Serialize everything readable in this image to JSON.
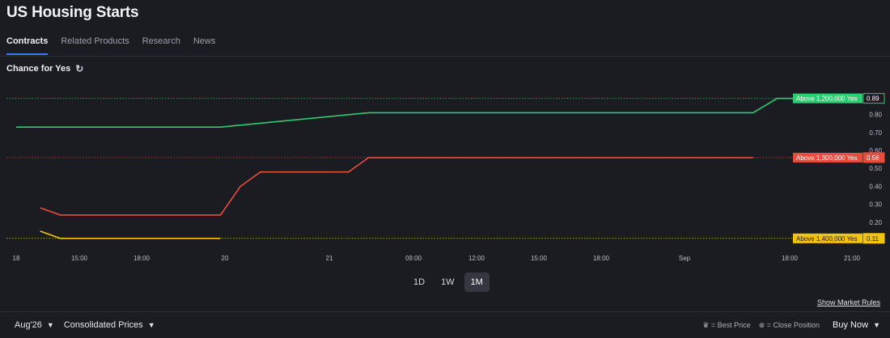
{
  "page": {
    "title": "US Housing Starts"
  },
  "tabs": [
    {
      "label": "Contracts",
      "active": true
    },
    {
      "label": "Related Products"
    },
    {
      "label": "Research"
    },
    {
      "label": "News"
    }
  ],
  "chart_header": {
    "label": "Chance for Yes"
  },
  "chart_data": {
    "type": "line",
    "y_ticks": [
      "0.20",
      "0.30",
      "0.40",
      "0.50",
      "0.60",
      "0.70",
      "0.80"
    ],
    "x_ticks": [
      "18",
      "15:00",
      "18:00",
      "20",
      "21",
      "09:00",
      "12:00",
      "15:00",
      "18:00",
      "Sep",
      "18:00",
      "21:00"
    ],
    "ylim": [
      0.1,
      0.92
    ],
    "series": [
      {
        "name": "Above 1,200,000 Yes",
        "color": "#2ecc71",
        "last": "0.89",
        "x": [
          0.0,
          0.255,
          0.44,
          0.92,
          0.95,
          1.1
        ],
        "y": [
          0.73,
          0.73,
          0.81,
          0.81,
          0.89,
          0.89
        ]
      },
      {
        "name": "Above 1,300,000 Yes",
        "color": "#e74c3c",
        "last": "0.56",
        "x": [
          0.03,
          0.055,
          0.255,
          0.28,
          0.305,
          0.415,
          0.44,
          0.92
        ],
        "y": [
          0.28,
          0.24,
          0.24,
          0.4,
          0.48,
          0.48,
          0.56,
          0.56
        ]
      },
      {
        "name": "Above 1,400,000 Yes",
        "color": "#f1c40f",
        "last": "0.11",
        "x": [
          0.03,
          0.055,
          0.255
        ],
        "y": [
          0.15,
          0.11,
          0.11
        ]
      }
    ],
    "grid": false
  },
  "range_buttons": [
    {
      "label": "1D"
    },
    {
      "label": "1W"
    },
    {
      "label": "1M",
      "active": true
    }
  ],
  "links": {
    "market_rules": "Show Market Rules"
  },
  "footer": {
    "contract_month": "Aug'26",
    "price_mode": "Consolidated Prices",
    "best_price": "= Best Price",
    "close_position": "= Close Position",
    "buy": "Buy Now"
  }
}
